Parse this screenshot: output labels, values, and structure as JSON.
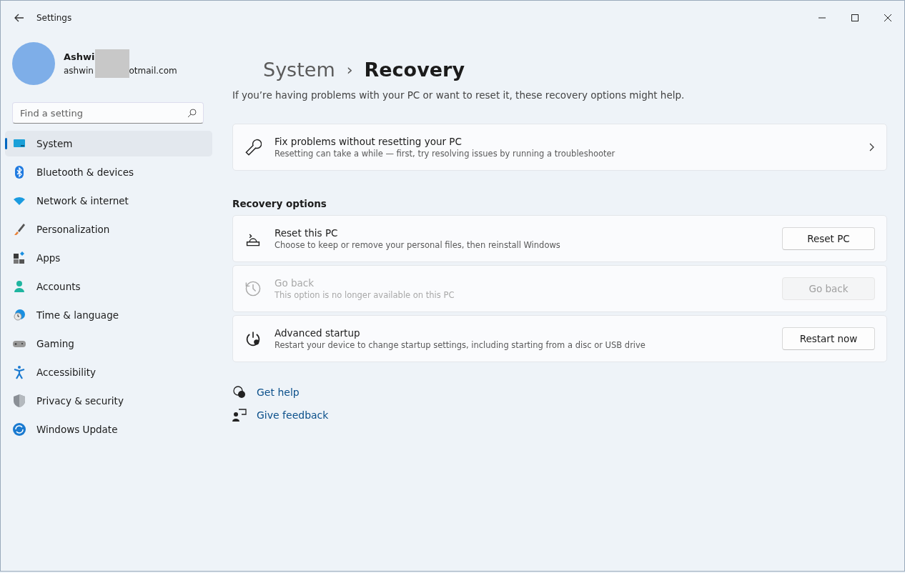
{
  "window": {
    "title": "Settings"
  },
  "account": {
    "name": "Ashwi",
    "email_start": "ashwin",
    "email_end": "otmail.com"
  },
  "search": {
    "placeholder": "Find a setting"
  },
  "sidebar": {
    "items": [
      {
        "label": "System",
        "selected": true
      },
      {
        "label": "Bluetooth & devices",
        "selected": false
      },
      {
        "label": "Network & internet",
        "selected": false
      },
      {
        "label": "Personalization",
        "selected": false
      },
      {
        "label": "Apps",
        "selected": false
      },
      {
        "label": "Accounts",
        "selected": false
      },
      {
        "label": "Time & language",
        "selected": false
      },
      {
        "label": "Gaming",
        "selected": false
      },
      {
        "label": "Accessibility",
        "selected": false
      },
      {
        "label": "Privacy & security",
        "selected": false
      },
      {
        "label": "Windows Update",
        "selected": false
      }
    ]
  },
  "breadcrumb": {
    "parent": "System",
    "separator": "›",
    "current": "Recovery"
  },
  "intro": "If you’re having problems with your PC or want to reset it, these recovery options might help.",
  "fix_card": {
    "title": "Fix problems without resetting your PC",
    "description": "Resetting can take a while — first, try resolving issues by running a troubleshooter"
  },
  "section_title": "Recovery options",
  "options": [
    {
      "title": "Reset this PC",
      "description": "Choose to keep or remove your personal files, then reinstall Windows",
      "button": "Reset PC",
      "disabled": false
    },
    {
      "title": "Go back",
      "description": "This option is no longer available on this PC",
      "button": "Go back",
      "disabled": true
    },
    {
      "title": "Advanced startup",
      "description": "Restart your device to change startup settings, including starting from a disc or USB drive",
      "button": "Restart now",
      "disabled": false
    }
  ],
  "links": [
    "Get help",
    "Give feedback"
  ]
}
